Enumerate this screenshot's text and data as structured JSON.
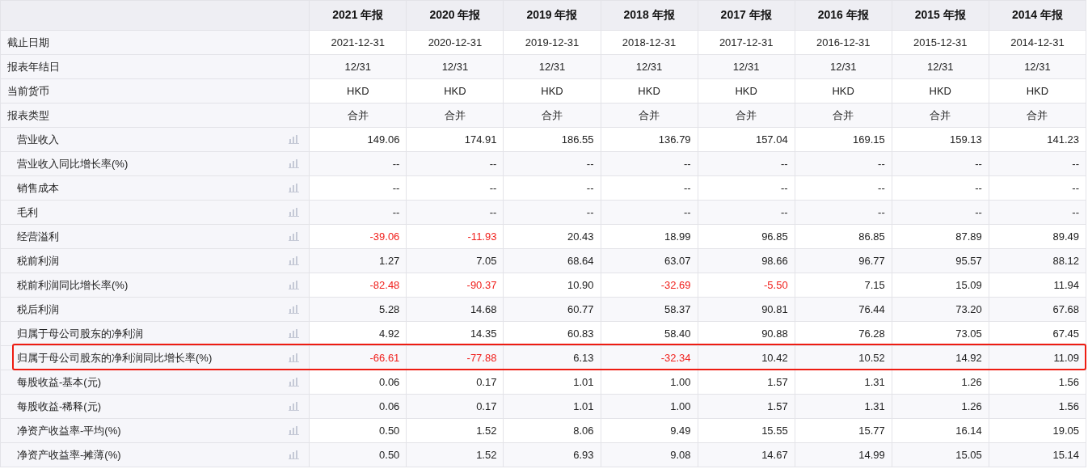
{
  "columns": [
    "2021 年报",
    "2020 年报",
    "2019 年报",
    "2018 年报",
    "2017 年报",
    "2016 年报",
    "2015 年报",
    "2014 年报"
  ],
  "rows": [
    {
      "kind": "info",
      "label": "截止日期",
      "highlighted": false,
      "values": [
        "2021-12-31",
        "2020-12-31",
        "2019-12-31",
        "2018-12-31",
        "2017-12-31",
        "2016-12-31",
        "2015-12-31",
        "2014-12-31"
      ]
    },
    {
      "kind": "info",
      "label": "报表年结日",
      "highlighted": false,
      "values": [
        "12/31",
        "12/31",
        "12/31",
        "12/31",
        "12/31",
        "12/31",
        "12/31",
        "12/31"
      ]
    },
    {
      "kind": "info",
      "label": "当前货币",
      "highlighted": false,
      "values": [
        "HKD",
        "HKD",
        "HKD",
        "HKD",
        "HKD",
        "HKD",
        "HKD",
        "HKD"
      ]
    },
    {
      "kind": "info",
      "label": "报表类型",
      "highlighted": false,
      "values": [
        "合并",
        "合并",
        "合并",
        "合并",
        "合并",
        "合并",
        "合并",
        "合并"
      ]
    },
    {
      "kind": "metric",
      "label": "营业收入",
      "highlighted": false,
      "values": [
        "149.06",
        "174.91",
        "186.55",
        "136.79",
        "157.04",
        "169.15",
        "159.13",
        "141.23"
      ],
      "negative": [
        false,
        false,
        false,
        false,
        false,
        false,
        false,
        false
      ]
    },
    {
      "kind": "metric",
      "label": "营业收入同比增长率(%)",
      "highlighted": false,
      "values": [
        "--",
        "--",
        "--",
        "--",
        "--",
        "--",
        "--",
        "--"
      ],
      "negative": [
        false,
        false,
        false,
        false,
        false,
        false,
        false,
        false
      ]
    },
    {
      "kind": "metric",
      "label": "销售成本",
      "highlighted": false,
      "values": [
        "--",
        "--",
        "--",
        "--",
        "--",
        "--",
        "--",
        "--"
      ],
      "negative": [
        false,
        false,
        false,
        false,
        false,
        false,
        false,
        false
      ]
    },
    {
      "kind": "metric",
      "label": "毛利",
      "highlighted": false,
      "values": [
        "--",
        "--",
        "--",
        "--",
        "--",
        "--",
        "--",
        "--"
      ],
      "negative": [
        false,
        false,
        false,
        false,
        false,
        false,
        false,
        false
      ]
    },
    {
      "kind": "metric",
      "label": "经营溢利",
      "highlighted": false,
      "values": [
        "-39.06",
        "-11.93",
        "20.43",
        "18.99",
        "96.85",
        "86.85",
        "87.89",
        "89.49"
      ],
      "negative": [
        true,
        true,
        false,
        false,
        false,
        false,
        false,
        false
      ]
    },
    {
      "kind": "metric",
      "label": "税前利润",
      "highlighted": false,
      "values": [
        "1.27",
        "7.05",
        "68.64",
        "63.07",
        "98.66",
        "96.77",
        "95.57",
        "88.12"
      ],
      "negative": [
        false,
        false,
        false,
        false,
        false,
        false,
        false,
        false
      ]
    },
    {
      "kind": "metric",
      "label": "税前利润同比增长率(%)",
      "highlighted": false,
      "values": [
        "-82.48",
        "-90.37",
        "10.90",
        "-32.69",
        "-5.50",
        "7.15",
        "15.09",
        "11.94"
      ],
      "negative": [
        true,
        true,
        false,
        true,
        true,
        false,
        false,
        false
      ]
    },
    {
      "kind": "metric",
      "label": "税后利润",
      "highlighted": false,
      "values": [
        "5.28",
        "14.68",
        "60.77",
        "58.37",
        "90.81",
        "76.44",
        "73.20",
        "67.68"
      ],
      "negative": [
        false,
        false,
        false,
        false,
        false,
        false,
        false,
        false
      ]
    },
    {
      "kind": "metric",
      "label": "归属于母公司股东的净利润",
      "highlighted": false,
      "values": [
        "4.92",
        "14.35",
        "60.83",
        "58.40",
        "90.88",
        "76.28",
        "73.05",
        "67.45"
      ],
      "negative": [
        false,
        false,
        false,
        false,
        false,
        false,
        false,
        false
      ]
    },
    {
      "kind": "metric",
      "label": "归属于母公司股东的净利润同比增长率(%)",
      "highlighted": true,
      "values": [
        "-66.61",
        "-77.88",
        "6.13",
        "-32.34",
        "10.42",
        "10.52",
        "14.92",
        "11.09"
      ],
      "negative": [
        true,
        true,
        false,
        true,
        false,
        false,
        false,
        false
      ]
    },
    {
      "kind": "metric",
      "label": "每股收益-基本(元)",
      "highlighted": false,
      "values": [
        "0.06",
        "0.17",
        "1.01",
        "1.00",
        "1.57",
        "1.31",
        "1.26",
        "1.56"
      ],
      "negative": [
        false,
        false,
        false,
        false,
        false,
        false,
        false,
        false
      ]
    },
    {
      "kind": "metric",
      "label": "每股收益-稀释(元)",
      "highlighted": false,
      "values": [
        "0.06",
        "0.17",
        "1.01",
        "1.00",
        "1.57",
        "1.31",
        "1.26",
        "1.56"
      ],
      "negative": [
        false,
        false,
        false,
        false,
        false,
        false,
        false,
        false
      ]
    },
    {
      "kind": "metric",
      "label": "净资产收益率-平均(%)",
      "highlighted": false,
      "values": [
        "0.50",
        "1.52",
        "8.06",
        "9.49",
        "15.55",
        "15.77",
        "16.14",
        "19.05"
      ],
      "negative": [
        false,
        false,
        false,
        false,
        false,
        false,
        false,
        false
      ]
    },
    {
      "kind": "metric",
      "label": "净资产收益率-摊薄(%)",
      "highlighted": false,
      "values": [
        "0.50",
        "1.52",
        "6.93",
        "9.08",
        "14.67",
        "14.99",
        "15.05",
        "15.14"
      ],
      "negative": [
        false,
        false,
        false,
        false,
        false,
        false,
        false,
        false
      ]
    }
  ]
}
